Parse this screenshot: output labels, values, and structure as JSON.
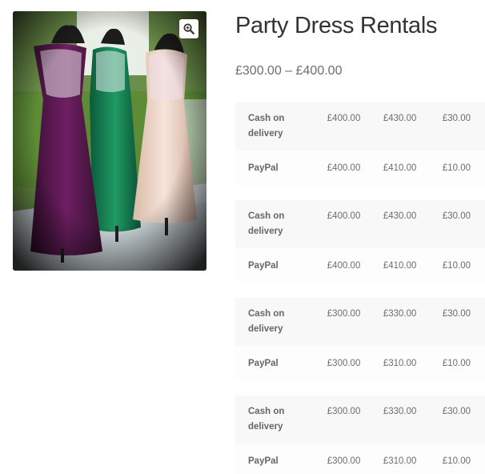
{
  "product": {
    "title": "Party Dress Rentals",
    "price_range": "£300.00 – £400.00",
    "image_alt": "dress-mannequins-photo",
    "zoom_icon": "magnifier-icon"
  },
  "rate_tables": [
    {
      "rows": [
        {
          "method": "Cash on delivery",
          "col1": "£400.00",
          "col2": "£430.00",
          "col3": "£30.00"
        },
        {
          "method": "PayPal",
          "col1": "£400.00",
          "col2": "£410.00",
          "col3": "£10.00"
        }
      ]
    },
    {
      "rows": [
        {
          "method": "Cash on delivery",
          "col1": "£400.00",
          "col2": "£430.00",
          "col3": "£30.00"
        },
        {
          "method": "PayPal",
          "col1": "£400.00",
          "col2": "£410.00",
          "col3": "£10.00"
        }
      ]
    },
    {
      "rows": [
        {
          "method": "Cash on delivery",
          "col1": "£300.00",
          "col2": "£330.00",
          "col3": "£30.00"
        },
        {
          "method": "PayPal",
          "col1": "£300.00",
          "col2": "£310.00",
          "col3": "£10.00"
        }
      ]
    },
    {
      "rows": [
        {
          "method": "Cash on delivery",
          "col1": "£300.00",
          "col2": "£330.00",
          "col3": "£30.00"
        },
        {
          "method": "PayPal",
          "col1": "£300.00",
          "col2": "£310.00",
          "col3": "£10.00"
        }
      ]
    }
  ],
  "colors": {
    "title": "#333333",
    "text": "#6d6d6d",
    "row_bg": "#f8f8f8"
  }
}
